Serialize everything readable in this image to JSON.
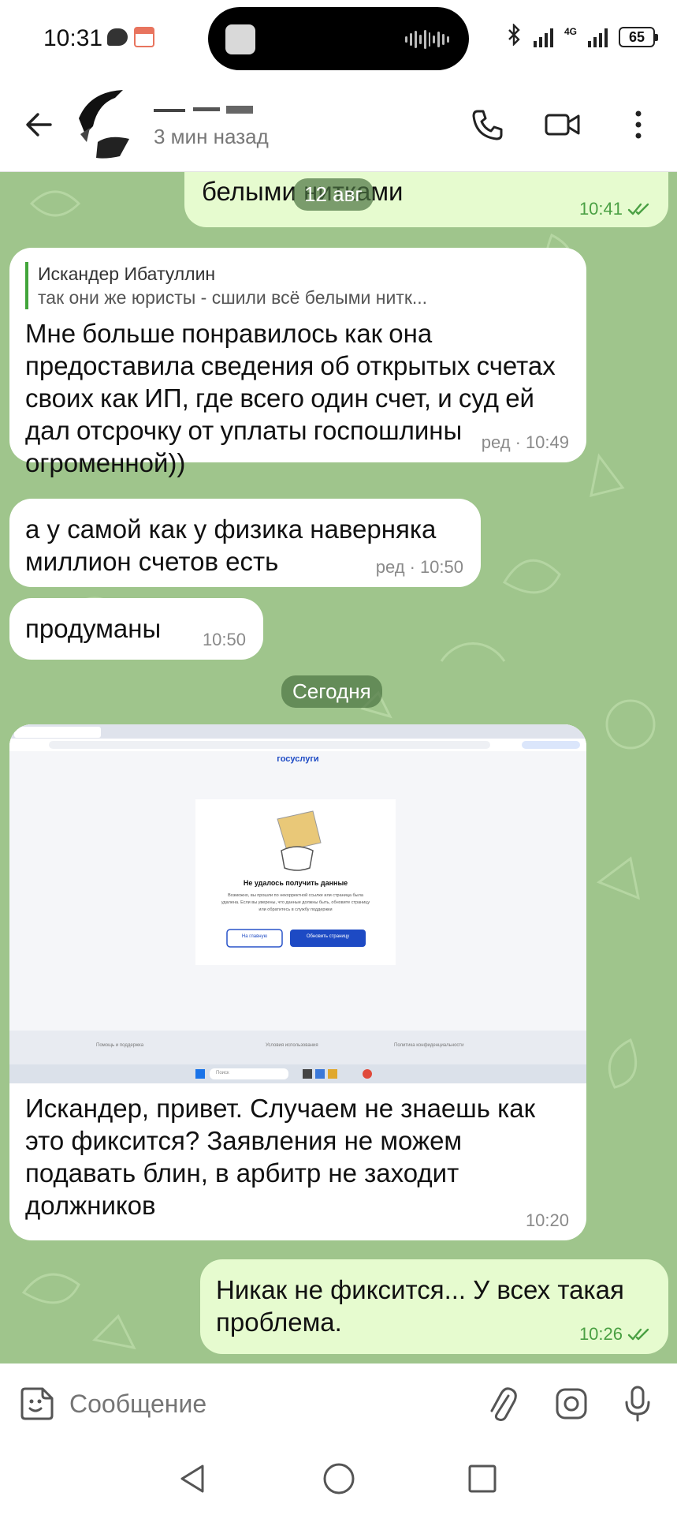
{
  "status_bar": {
    "time": "10:31",
    "network": "4G",
    "battery": "65",
    "icons": [
      "message-icon",
      "calendar-icon",
      "music-art-icon",
      "waveform-icon",
      "bluetooth-icon",
      "signal-icon",
      "signal-4g-icon",
      "battery-icon"
    ]
  },
  "header": {
    "contact_name": "",
    "last_seen": "3 мин назад",
    "icons": [
      "back-arrow-icon",
      "avatar",
      "phone-icon",
      "video-camera-icon",
      "more-vert-icon"
    ]
  },
  "messages": [
    {
      "id": "m1",
      "type": "outgoing",
      "text": "белыми нитками",
      "time": "10:41",
      "read": true
    },
    {
      "id": "m2",
      "type": "incoming",
      "reply_to": {
        "author": "Искандер Ибатуллин",
        "text": "так они же юристы - сшили всё белыми нитк..."
      },
      "text": "Мне больше понравилось как она предоставила сведения об открытых счетах своих как ИП, где всего один счет, и суд ей дал отсрочку от уплаты госпошлины огроменной))",
      "edited_label": "ред",
      "time": "10:49"
    },
    {
      "id": "m3",
      "type": "incoming",
      "text": "а у самой как у физика наверняка миллион счетов есть",
      "edited_label": "ред",
      "time": "10:50"
    },
    {
      "id": "m4",
      "type": "incoming",
      "text": "продуманы",
      "time": "10:50"
    },
    {
      "id": "m5",
      "type": "incoming-media",
      "screenshot": {
        "site_logo": "госуслуги",
        "error_title": "Не удалось получить данные",
        "error_text_1": "Возможно, вы прошли по некорректной ссылке или страница была",
        "error_text_2": "удалена. Если вы уверены, что данные должны быть, обновите страницу",
        "error_text_3": "или обратитесь в службу поддержки",
        "btn_home": "На главную",
        "btn_refresh": "Обновить страницу",
        "footer_1": "Помощь и поддержка",
        "footer_2": "Условия использования",
        "footer_3": "Политика конфиденциальности",
        "search_placeholder": "Поиск"
      },
      "text": "Искандер, привет. Случаем не знаешь как это фиксится? Заявления не можем подавать блин, в арбитр не заходит должников",
      "time": "10:20"
    },
    {
      "id": "m6",
      "type": "outgoing",
      "text": "Никак не фиксится... У всех такая проблема.",
      "time": "10:26",
      "read": true
    }
  ],
  "date_pills": {
    "old": "12 авг",
    "today": "Сегодня"
  },
  "input": {
    "placeholder": "Сообщение",
    "icons": [
      "emoji-sticker-icon",
      "attach-paperclip-icon",
      "camera-icon",
      "microphone-icon"
    ]
  },
  "navbar": {
    "icons": [
      "nav-back-icon",
      "nav-home-icon",
      "nav-recents-icon"
    ]
  },
  "colors": {
    "chat_bg": "#9fc58c",
    "outgoing": "#e6fbcf",
    "accent": "#42a53a",
    "gosuslugi_blue": "#1d4ac4"
  }
}
